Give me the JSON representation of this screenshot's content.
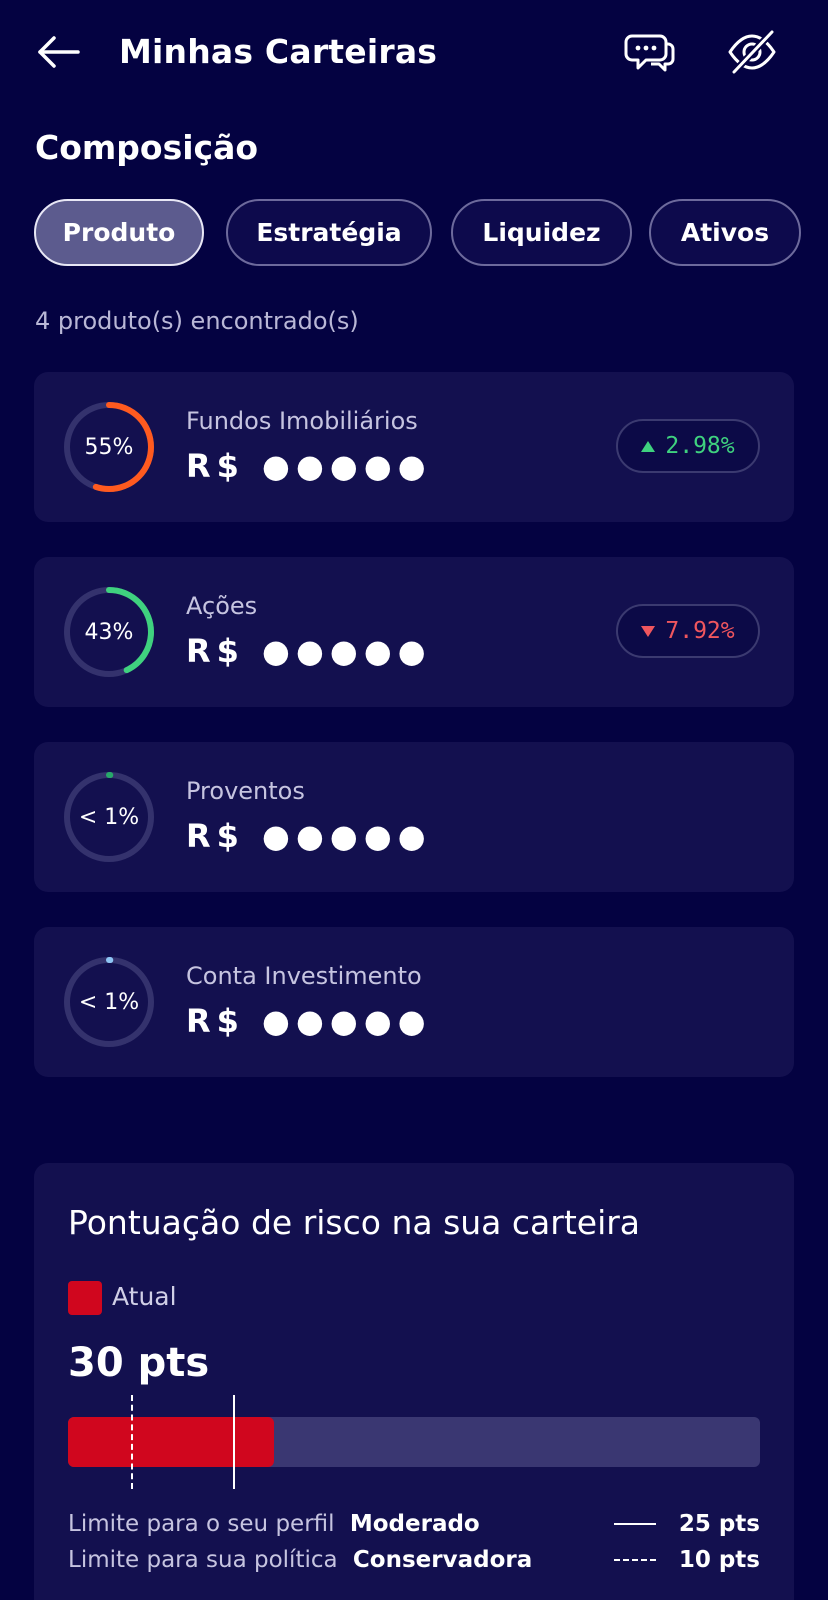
{
  "header": {
    "title": "Minhas Carteiras",
    "back_icon": "arrow-left-icon",
    "chat_icon": "chat-bubbles-icon",
    "hide_icon": "eye-off-icon"
  },
  "composition": {
    "title": "Composição",
    "tabs": [
      {
        "label": "Produto",
        "active": true
      },
      {
        "label": "Estratégia",
        "active": false
      },
      {
        "label": "Liquidez",
        "active": false
      },
      {
        "label": "Ativos",
        "active": false
      }
    ],
    "count_text": "4 produto(s) encontrado(s)",
    "products": [
      {
        "name": "Fundos Imobiliários",
        "percent_label": "55%",
        "share": 0.55,
        "ring_color": "#ff5a1f",
        "value": "R$ ●●●●●",
        "change": "2.98%",
        "direction": "up"
      },
      {
        "name": "Ações",
        "percent_label": "43%",
        "share": 0.43,
        "ring_color": "#3fd27f",
        "value": "R$ ●●●●●",
        "change": "7.92%",
        "direction": "down"
      },
      {
        "name": "Proventos",
        "percent_label": "< 1%",
        "share": 0.005,
        "ring_color": "#27a86a",
        "value": "R$ ●●●●●",
        "change": null,
        "direction": null
      },
      {
        "name": "Conta Investimento",
        "percent_label": "< 1%",
        "share": 0.005,
        "ring_color": "#8ec5f5",
        "value": "R$ ●●●●●",
        "change": null,
        "direction": null
      }
    ]
  },
  "risk": {
    "title": "Pontuação de risco na sua carteira",
    "legend_label": "Atual",
    "legend_color": "#d0061e",
    "score_label": "30 pts",
    "bar_max": 100,
    "current": 30,
    "profile_limit": 25,
    "policy_limit": 10,
    "profile_row": {
      "prefix": "Limite para o seu perfil",
      "name": "Moderado",
      "pts": "25 pts"
    },
    "policy_row": {
      "prefix": "Limite para sua política",
      "name": "Conservadora",
      "pts": "10 pts"
    }
  }
}
